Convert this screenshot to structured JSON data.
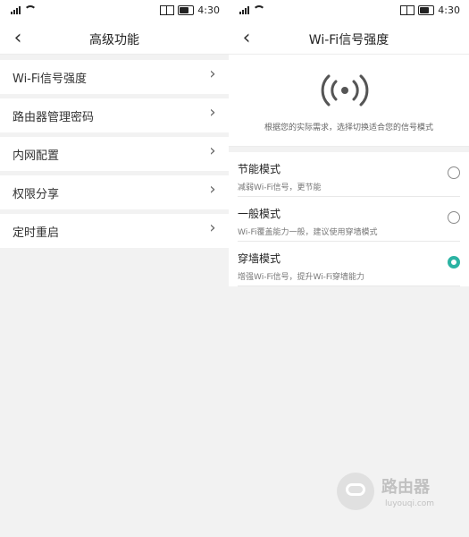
{
  "left_screen": {
    "status_time": "4:30",
    "title": "高级功能",
    "menu": [
      {
        "label": "Wi-Fi信号强度"
      },
      {
        "label": "路由器管理密码"
      },
      {
        "label": "内网配置"
      },
      {
        "label": "权限分享"
      },
      {
        "label": "定时重启"
      }
    ]
  },
  "right_screen": {
    "status_time": "4:30",
    "title": "Wi-Fi信号强度",
    "description": "根据您的实际需求，选择切换适合您的信号模式",
    "modes": [
      {
        "title": "节能模式",
        "desc": "减弱Wi-Fi信号，更节能",
        "selected": false
      },
      {
        "title": "一般模式",
        "desc": "Wi-Fi覆盖能力一般，建议使用穿墙模式",
        "selected": false
      },
      {
        "title": "穿墙模式",
        "desc": "增强Wi-Fi信号，提升Wi-Fi穿墙能力",
        "selected": true
      }
    ],
    "accent_color": "#2bb3a3"
  },
  "watermark": {
    "title": "路由器",
    "subtitle": "luyouqi.com"
  },
  "icons": {
    "back": "chevron-left-icon",
    "item_arrow": "chevron-right-icon",
    "hero": "broadcast-icon"
  }
}
